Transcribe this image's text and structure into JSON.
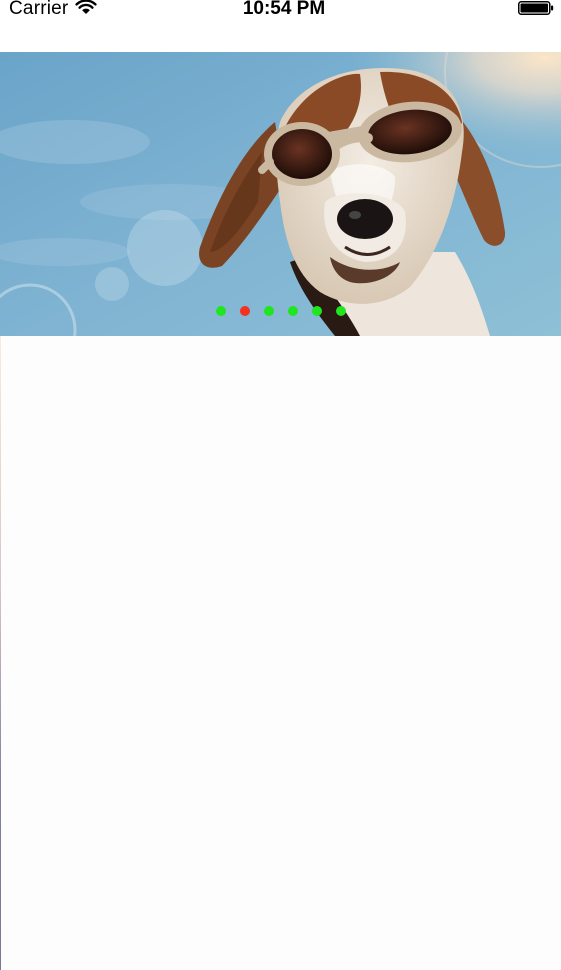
{
  "status_bar": {
    "carrier": "Carrier",
    "time": "10:54 PM",
    "wifi_icon": "wifi-icon",
    "battery_icon": "battery-icon"
  },
  "carousel": {
    "page_count": 6,
    "current_page_index": 1,
    "active_dot_color": "#f5311f",
    "inactive_dot_color": "#1fe61f"
  }
}
